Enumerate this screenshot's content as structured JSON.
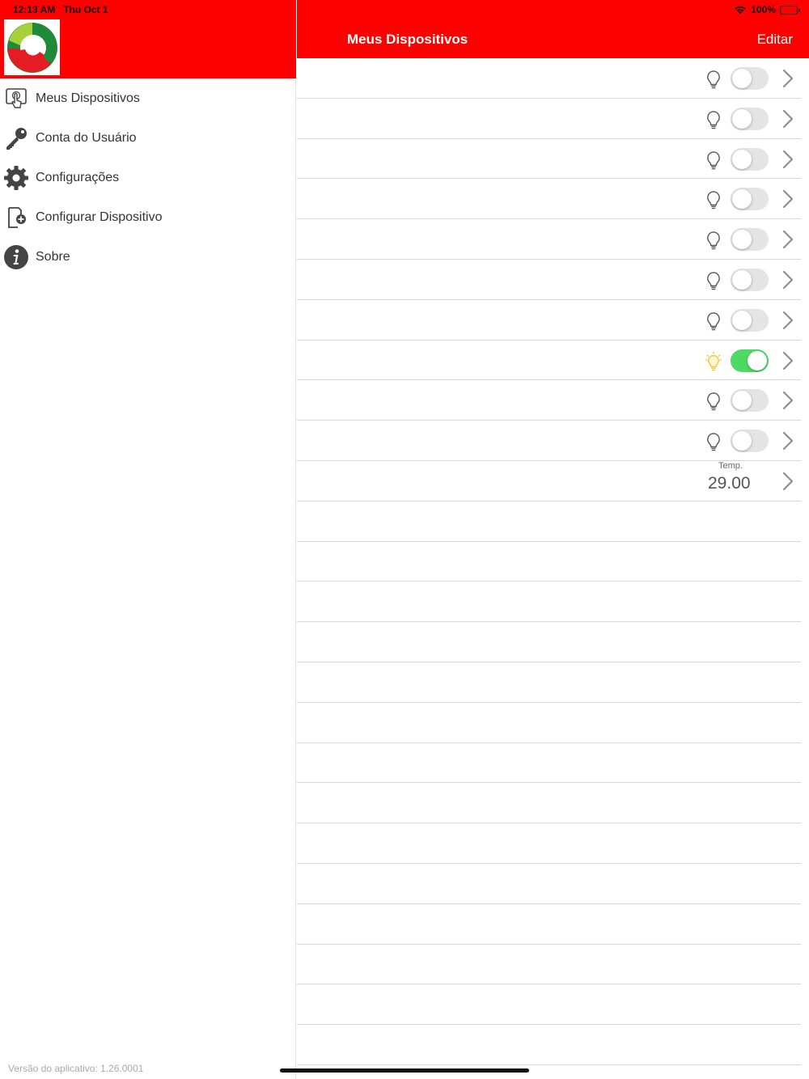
{
  "status_bar": {
    "time": "12:13 AM",
    "date": "Thu Oct 1",
    "battery": "100%"
  },
  "colors": {
    "header_red": "#fd0000",
    "toggle_on": "#4cd964",
    "toggle_off": "#e4e4e4",
    "bulb_on": "#f6c531"
  },
  "sidebar": {
    "items": [
      {
        "label": "Meus Dispositivos",
        "icon": "touch-device-icon"
      },
      {
        "label": "Conta do Usuário",
        "icon": "key-icon"
      },
      {
        "label": "Configurações",
        "icon": "gear-icon"
      },
      {
        "label": "Configurar Dispositivo",
        "icon": "add-device-icon"
      },
      {
        "label": "Sobre",
        "icon": "info-icon"
      }
    ],
    "version": "Versão do aplicativo: 1.26.0001"
  },
  "navbar": {
    "title": "Meus Dispositivos",
    "edit": "Editar"
  },
  "devices": [
    {
      "type": "light",
      "on": false
    },
    {
      "type": "light",
      "on": false
    },
    {
      "type": "light",
      "on": false
    },
    {
      "type": "light",
      "on": false
    },
    {
      "type": "light",
      "on": false
    },
    {
      "type": "light",
      "on": false
    },
    {
      "type": "light",
      "on": false
    },
    {
      "type": "light",
      "on": true
    },
    {
      "type": "light",
      "on": false
    },
    {
      "type": "light",
      "on": false
    },
    {
      "type": "temperature",
      "label": "Temp.",
      "value": "29.00"
    }
  ],
  "empty_rows": 14
}
